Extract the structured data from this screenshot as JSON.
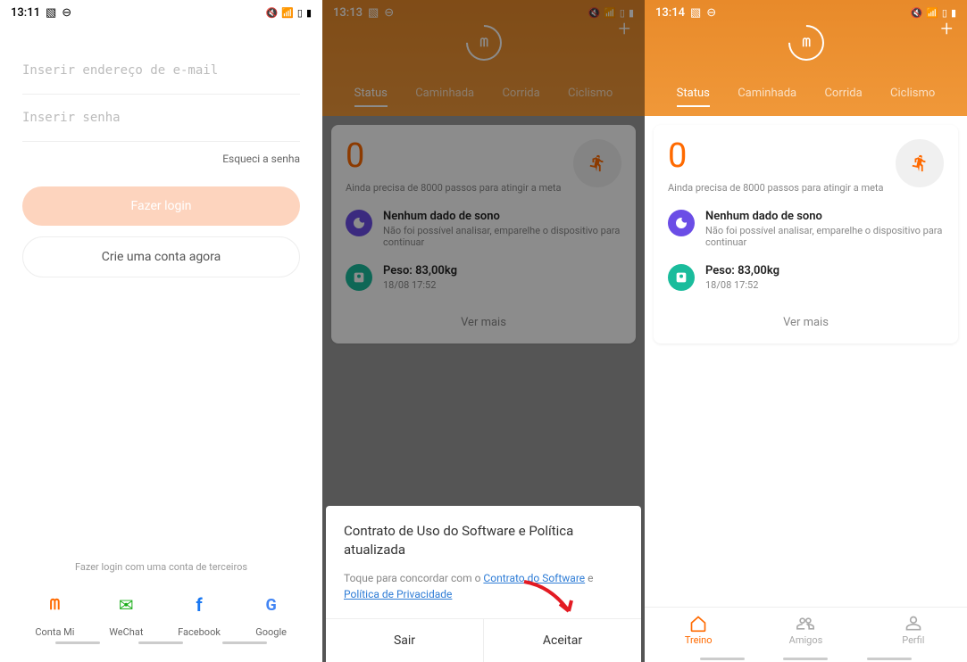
{
  "screen1": {
    "time": "13:11",
    "email_placeholder": "Inserir endereço de e-mail",
    "password_placeholder": "Inserir senha",
    "forgot": "Esqueci a senha",
    "login_btn": "Fazer login",
    "create_btn": "Crie uma conta agora",
    "third_party_label": "Fazer login com uma conta de terceiros",
    "providers": {
      "mi": "Conta Mi",
      "wechat": "WeChat",
      "facebook": "Facebook",
      "google": "Google"
    }
  },
  "screen2": {
    "time": "13:13",
    "tabs": {
      "status": "Status",
      "walk": "Caminhada",
      "run": "Corrida",
      "cycle": "Ciclismo"
    },
    "steps": "0",
    "steps_sub": "Ainda precisa de 8000 passos para atingir a meta",
    "sleep_title": "Nenhum dado de sono",
    "sleep_sub": "Não foi possível analisar, emparelhe o dispositivo para continuar",
    "weight_title": "Peso: 83,00kg",
    "weight_sub": "18/08 17:52",
    "see_more": "Ver mais",
    "dialog": {
      "title": "Contrato de Uso do Software e Política atualizada",
      "text_prefix": "Toque para concordar com o ",
      "link1": "Contrato do Software",
      "text_mid": " e ",
      "link2": "Política de Privacidade",
      "exit": "Sair",
      "accept": "Aceitar"
    }
  },
  "screen3": {
    "time": "13:14",
    "tabs": {
      "status": "Status",
      "walk": "Caminhada",
      "run": "Corrida",
      "cycle": "Ciclismo"
    },
    "steps": "0",
    "steps_sub": "Ainda precisa de 8000 passos para atingir a meta",
    "sleep_title": "Nenhum dado de sono",
    "sleep_sub": "Não foi possível analisar, emparelhe o dispositivo para continuar",
    "weight_title": "Peso: 83,00kg",
    "weight_sub": "18/08 17:52",
    "see_more": "Ver mais",
    "nav": {
      "train": "Treino",
      "friends": "Amigos",
      "profile": "Perfil"
    }
  }
}
